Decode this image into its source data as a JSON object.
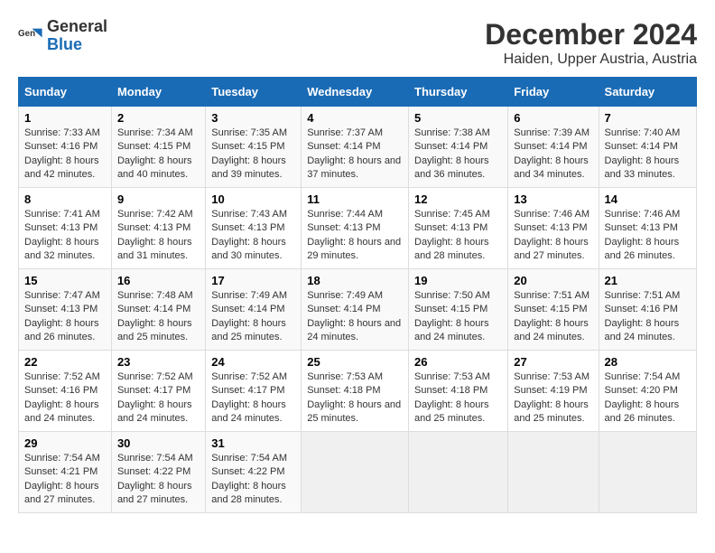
{
  "logo": {
    "line1": "General",
    "line2": "Blue"
  },
  "title": "December 2024",
  "subtitle": "Haiden, Upper Austria, Austria",
  "days_of_week": [
    "Sunday",
    "Monday",
    "Tuesday",
    "Wednesday",
    "Thursday",
    "Friday",
    "Saturday"
  ],
  "weeks": [
    [
      {
        "day": 1,
        "sunrise": "7:33 AM",
        "sunset": "4:16 PM",
        "daylight": "8 hours and 42 minutes."
      },
      {
        "day": 2,
        "sunrise": "7:34 AM",
        "sunset": "4:15 PM",
        "daylight": "8 hours and 40 minutes."
      },
      {
        "day": 3,
        "sunrise": "7:35 AM",
        "sunset": "4:15 PM",
        "daylight": "8 hours and 39 minutes."
      },
      {
        "day": 4,
        "sunrise": "7:37 AM",
        "sunset": "4:14 PM",
        "daylight": "8 hours and 37 minutes."
      },
      {
        "day": 5,
        "sunrise": "7:38 AM",
        "sunset": "4:14 PM",
        "daylight": "8 hours and 36 minutes."
      },
      {
        "day": 6,
        "sunrise": "7:39 AM",
        "sunset": "4:14 PM",
        "daylight": "8 hours and 34 minutes."
      },
      {
        "day": 7,
        "sunrise": "7:40 AM",
        "sunset": "4:14 PM",
        "daylight": "8 hours and 33 minutes."
      }
    ],
    [
      {
        "day": 8,
        "sunrise": "7:41 AM",
        "sunset": "4:13 PM",
        "daylight": "8 hours and 32 minutes."
      },
      {
        "day": 9,
        "sunrise": "7:42 AM",
        "sunset": "4:13 PM",
        "daylight": "8 hours and 31 minutes."
      },
      {
        "day": 10,
        "sunrise": "7:43 AM",
        "sunset": "4:13 PM",
        "daylight": "8 hours and 30 minutes."
      },
      {
        "day": 11,
        "sunrise": "7:44 AM",
        "sunset": "4:13 PM",
        "daylight": "8 hours and 29 minutes."
      },
      {
        "day": 12,
        "sunrise": "7:45 AM",
        "sunset": "4:13 PM",
        "daylight": "8 hours and 28 minutes."
      },
      {
        "day": 13,
        "sunrise": "7:46 AM",
        "sunset": "4:13 PM",
        "daylight": "8 hours and 27 minutes."
      },
      {
        "day": 14,
        "sunrise": "7:46 AM",
        "sunset": "4:13 PM",
        "daylight": "8 hours and 26 minutes."
      }
    ],
    [
      {
        "day": 15,
        "sunrise": "7:47 AM",
        "sunset": "4:13 PM",
        "daylight": "8 hours and 26 minutes."
      },
      {
        "day": 16,
        "sunrise": "7:48 AM",
        "sunset": "4:14 PM",
        "daylight": "8 hours and 25 minutes."
      },
      {
        "day": 17,
        "sunrise": "7:49 AM",
        "sunset": "4:14 PM",
        "daylight": "8 hours and 25 minutes."
      },
      {
        "day": 18,
        "sunrise": "7:49 AM",
        "sunset": "4:14 PM",
        "daylight": "8 hours and 24 minutes."
      },
      {
        "day": 19,
        "sunrise": "7:50 AM",
        "sunset": "4:15 PM",
        "daylight": "8 hours and 24 minutes."
      },
      {
        "day": 20,
        "sunrise": "7:51 AM",
        "sunset": "4:15 PM",
        "daylight": "8 hours and 24 minutes."
      },
      {
        "day": 21,
        "sunrise": "7:51 AM",
        "sunset": "4:16 PM",
        "daylight": "8 hours and 24 minutes."
      }
    ],
    [
      {
        "day": 22,
        "sunrise": "7:52 AM",
        "sunset": "4:16 PM",
        "daylight": "8 hours and 24 minutes."
      },
      {
        "day": 23,
        "sunrise": "7:52 AM",
        "sunset": "4:17 PM",
        "daylight": "8 hours and 24 minutes."
      },
      {
        "day": 24,
        "sunrise": "7:52 AM",
        "sunset": "4:17 PM",
        "daylight": "8 hours and 24 minutes."
      },
      {
        "day": 25,
        "sunrise": "7:53 AM",
        "sunset": "4:18 PM",
        "daylight": "8 hours and 25 minutes."
      },
      {
        "day": 26,
        "sunrise": "7:53 AM",
        "sunset": "4:18 PM",
        "daylight": "8 hours and 25 minutes."
      },
      {
        "day": 27,
        "sunrise": "7:53 AM",
        "sunset": "4:19 PM",
        "daylight": "8 hours and 25 minutes."
      },
      {
        "day": 28,
        "sunrise": "7:54 AM",
        "sunset": "4:20 PM",
        "daylight": "8 hours and 26 minutes."
      }
    ],
    [
      {
        "day": 29,
        "sunrise": "7:54 AM",
        "sunset": "4:21 PM",
        "daylight": "8 hours and 27 minutes."
      },
      {
        "day": 30,
        "sunrise": "7:54 AM",
        "sunset": "4:22 PM",
        "daylight": "8 hours and 27 minutes."
      },
      {
        "day": 31,
        "sunrise": "7:54 AM",
        "sunset": "4:22 PM",
        "daylight": "8 hours and 28 minutes."
      },
      null,
      null,
      null,
      null
    ]
  ]
}
